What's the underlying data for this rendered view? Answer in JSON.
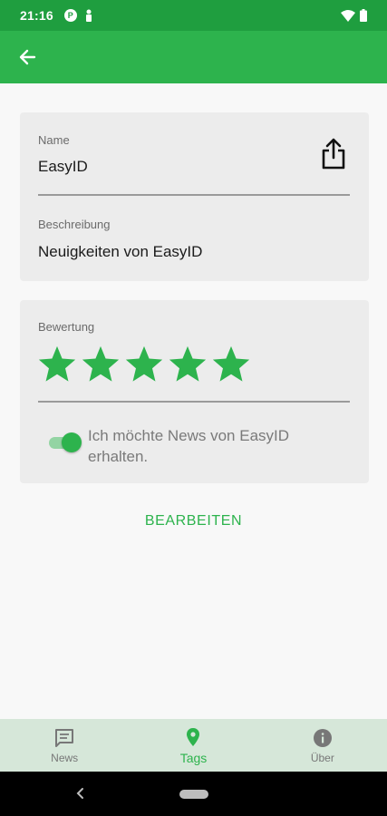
{
  "status_bar": {
    "time": "21:16",
    "left_icons": [
      "parking-icon",
      "person-icon"
    ],
    "right_icons": [
      "wifi-icon",
      "battery-icon"
    ]
  },
  "app_bar": {
    "back_icon": "arrow-back-icon",
    "color": "#2db34d"
  },
  "details": {
    "name_label": "Name",
    "name_value": "EasyID",
    "description_label": "Beschreibung",
    "description_value": "Neuigkeiten von EasyID",
    "share_icon": "share-icon"
  },
  "rating": {
    "label": "Bewertung",
    "value": 5,
    "max": 5,
    "star_color": "#2db34d"
  },
  "subscription": {
    "label": "Ich möchte News von EasyID erhalten.",
    "enabled": true
  },
  "actions": {
    "edit_label": "BEARBEITEN"
  },
  "bottom_nav": {
    "items": [
      {
        "label": "News",
        "icon": "news-icon",
        "active": false
      },
      {
        "label": "Tags",
        "icon": "location-pin-icon",
        "active": true
      },
      {
        "label": "Über",
        "icon": "info-icon",
        "active": false
      }
    ]
  },
  "colors": {
    "status_bar": "#1f9e3f",
    "accent": "#2db34d",
    "nav_background": "#d6e7d9"
  }
}
